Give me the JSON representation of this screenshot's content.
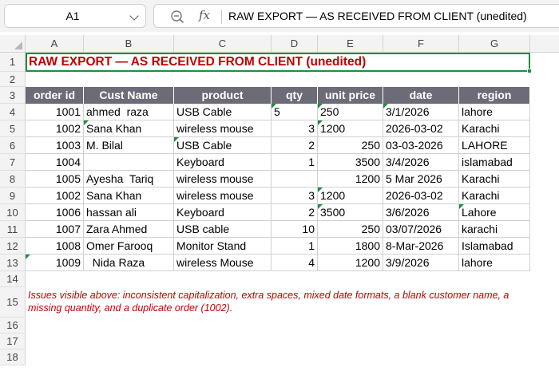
{
  "formula_bar": {
    "cell_ref": "A1",
    "fx_label": "fx",
    "content": "RAW EXPORT — AS RECEIVED FROM CLIENT (unedited)"
  },
  "columns": [
    "A",
    "B",
    "C",
    "D",
    "E",
    "F",
    "G"
  ],
  "rows": [
    "1",
    "2",
    "3",
    "4",
    "5",
    "6",
    "7",
    "8",
    "9",
    "10",
    "11",
    "12",
    "13",
    "14",
    "15",
    "16",
    "17",
    "18"
  ],
  "title": "RAW EXPORT — AS RECEIVED FROM CLIENT (unedited)",
  "table": {
    "headers": [
      "order id",
      "Cust Name",
      "product",
      "qty",
      "unit price",
      "date",
      "region"
    ],
    "rows": [
      {
        "order_id": "1001",
        "cust_name": "ahmed  raza",
        "product": "USB Cable",
        "qty": "5",
        "unit_price": "250",
        "date": "3/1/2026",
        "region": "lahore",
        "qty_text": true,
        "price_text": true
      },
      {
        "order_id": "1002",
        "cust_name": "Sana Khan",
        "product": "wireless mouse",
        "qty": "3",
        "unit_price": "1200",
        "date": "2026-03-02",
        "region": "Karachi",
        "qty_text": false,
        "price_text": true
      },
      {
        "order_id": "1003",
        "cust_name": "M. Bilal",
        "product": "USB Cable",
        "qty": "2",
        "unit_price": "250",
        "date": "03-03-2026",
        "region": "LAHORE",
        "qty_text": false,
        "price_text": false
      },
      {
        "order_id": "1004",
        "cust_name": "",
        "product": "Keyboard",
        "qty": "1",
        "unit_price": "3500",
        "date": "3/4/2026",
        "region": "islamabad",
        "qty_text": false,
        "price_text": false
      },
      {
        "order_id": "1005",
        "cust_name": "Ayesha  Tariq",
        "product": "wireless mouse",
        "qty": "",
        "unit_price": "1200",
        "date": "5 Mar 2026",
        "region": "Karachi",
        "qty_text": false,
        "price_text": false
      },
      {
        "order_id": "1002",
        "cust_name": "Sana Khan",
        "product": "wireless mouse",
        "qty": "3",
        "unit_price": "1200",
        "date": "2026-03-02",
        "region": "Karachi",
        "qty_text": false,
        "price_text": true
      },
      {
        "order_id": "1006",
        "cust_name": "hassan ali",
        "product": "Keyboard",
        "qty": "2",
        "unit_price": "3500",
        "date": "3/6/2026",
        "region": "Lahore",
        "qty_text": false,
        "price_text": true
      },
      {
        "order_id": "1007",
        "cust_name": "Zara Ahmed",
        "product": "USB cable",
        "qty": "10",
        "unit_price": "250",
        "date": "03/07/2026",
        "region": "karachi",
        "qty_text": false,
        "price_text": false
      },
      {
        "order_id": "1008",
        "cust_name": "Omer Farooq",
        "product": "Monitor Stand",
        "qty": "1",
        "unit_price": "1800",
        "date": "8-Mar-2026",
        "region": "Islamabad",
        "qty_text": false,
        "price_text": false
      },
      {
        "order_id": "1009",
        "cust_name": "  Nida Raza",
        "product": "wireless Mouse",
        "qty": "4",
        "unit_price": "1200",
        "date": "3/9/2026",
        "region": "lahore",
        "qty_text": false,
        "price_text": false
      }
    ]
  },
  "note": "Issues visible above: inconsistent capitalization, extra spaces, mixed date formats, a blank customer name, a missing quantity, and a duplicate order (1002).",
  "colors": {
    "accent_green": "#1e8e3e",
    "title_red": "#c00000",
    "header_gray": "#6c6c78"
  }
}
